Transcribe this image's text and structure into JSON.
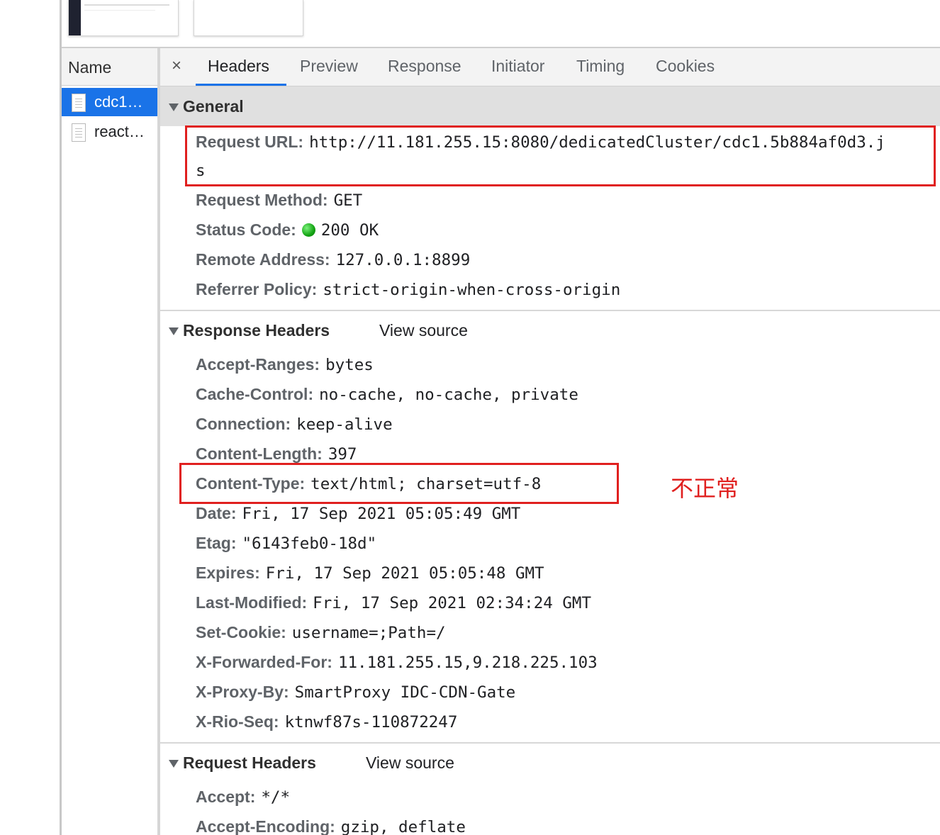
{
  "request_list": {
    "header": "Name",
    "items": [
      {
        "name": "cdc1…",
        "selected": true
      },
      {
        "name": "react…",
        "selected": false
      }
    ]
  },
  "tabs": {
    "close": "×",
    "items": [
      "Headers",
      "Preview",
      "Response",
      "Initiator",
      "Timing",
      "Cookies"
    ],
    "active": "Headers"
  },
  "general": {
    "title": "General",
    "rows": [
      {
        "key": "Request URL:",
        "value": "http://11.181.255.15:8080/dedicatedCluster/cdc1.5b884af0d3.j",
        "value_wrap": "s"
      },
      {
        "key": "Request Method:",
        "value": "GET"
      },
      {
        "key": "Status Code:",
        "value": "200 OK",
        "status_color": "#13a313"
      },
      {
        "key": "Remote Address:",
        "value": "127.0.0.1:8899"
      },
      {
        "key": "Referrer Policy:",
        "value": "strict-origin-when-cross-origin"
      }
    ]
  },
  "response_headers": {
    "title": "Response Headers",
    "view_source": "View source",
    "rows": [
      {
        "key": "Accept-Ranges:",
        "value": "bytes"
      },
      {
        "key": "Cache-Control:",
        "value": "no-cache, no-cache, private"
      },
      {
        "key": "Connection:",
        "value": "keep-alive"
      },
      {
        "key": "Content-Length:",
        "value": "397"
      },
      {
        "key": "Content-Type:",
        "value": "text/html; charset=utf-8"
      },
      {
        "key": "Date:",
        "value": "Fri, 17 Sep 2021 05:05:49 GMT"
      },
      {
        "key": "Etag:",
        "value": "\"6143feb0-18d\""
      },
      {
        "key": "Expires:",
        "value": "Fri, 17 Sep 2021 05:05:48 GMT"
      },
      {
        "key": "Last-Modified:",
        "value": "Fri, 17 Sep 2021 02:34:24 GMT"
      },
      {
        "key": "Set-Cookie:",
        "value": "username=;Path=/"
      },
      {
        "key": "X-Forwarded-For:",
        "value": "11.181.255.15,9.218.225.103"
      },
      {
        "key": "X-Proxy-By:",
        "value": "SmartProxy IDC-CDN-Gate"
      },
      {
        "key": "X-Rio-Seq:",
        "value": "ktnwf87s-110872247"
      }
    ]
  },
  "request_headers": {
    "title": "Request Headers",
    "view_source": "View source",
    "rows": [
      {
        "key": "Accept:",
        "value": "*/*"
      },
      {
        "key": "Accept-Encoding:",
        "value": "gzip, deflate"
      }
    ]
  },
  "annotation": {
    "text": "不正常",
    "color": "#e0201f"
  }
}
